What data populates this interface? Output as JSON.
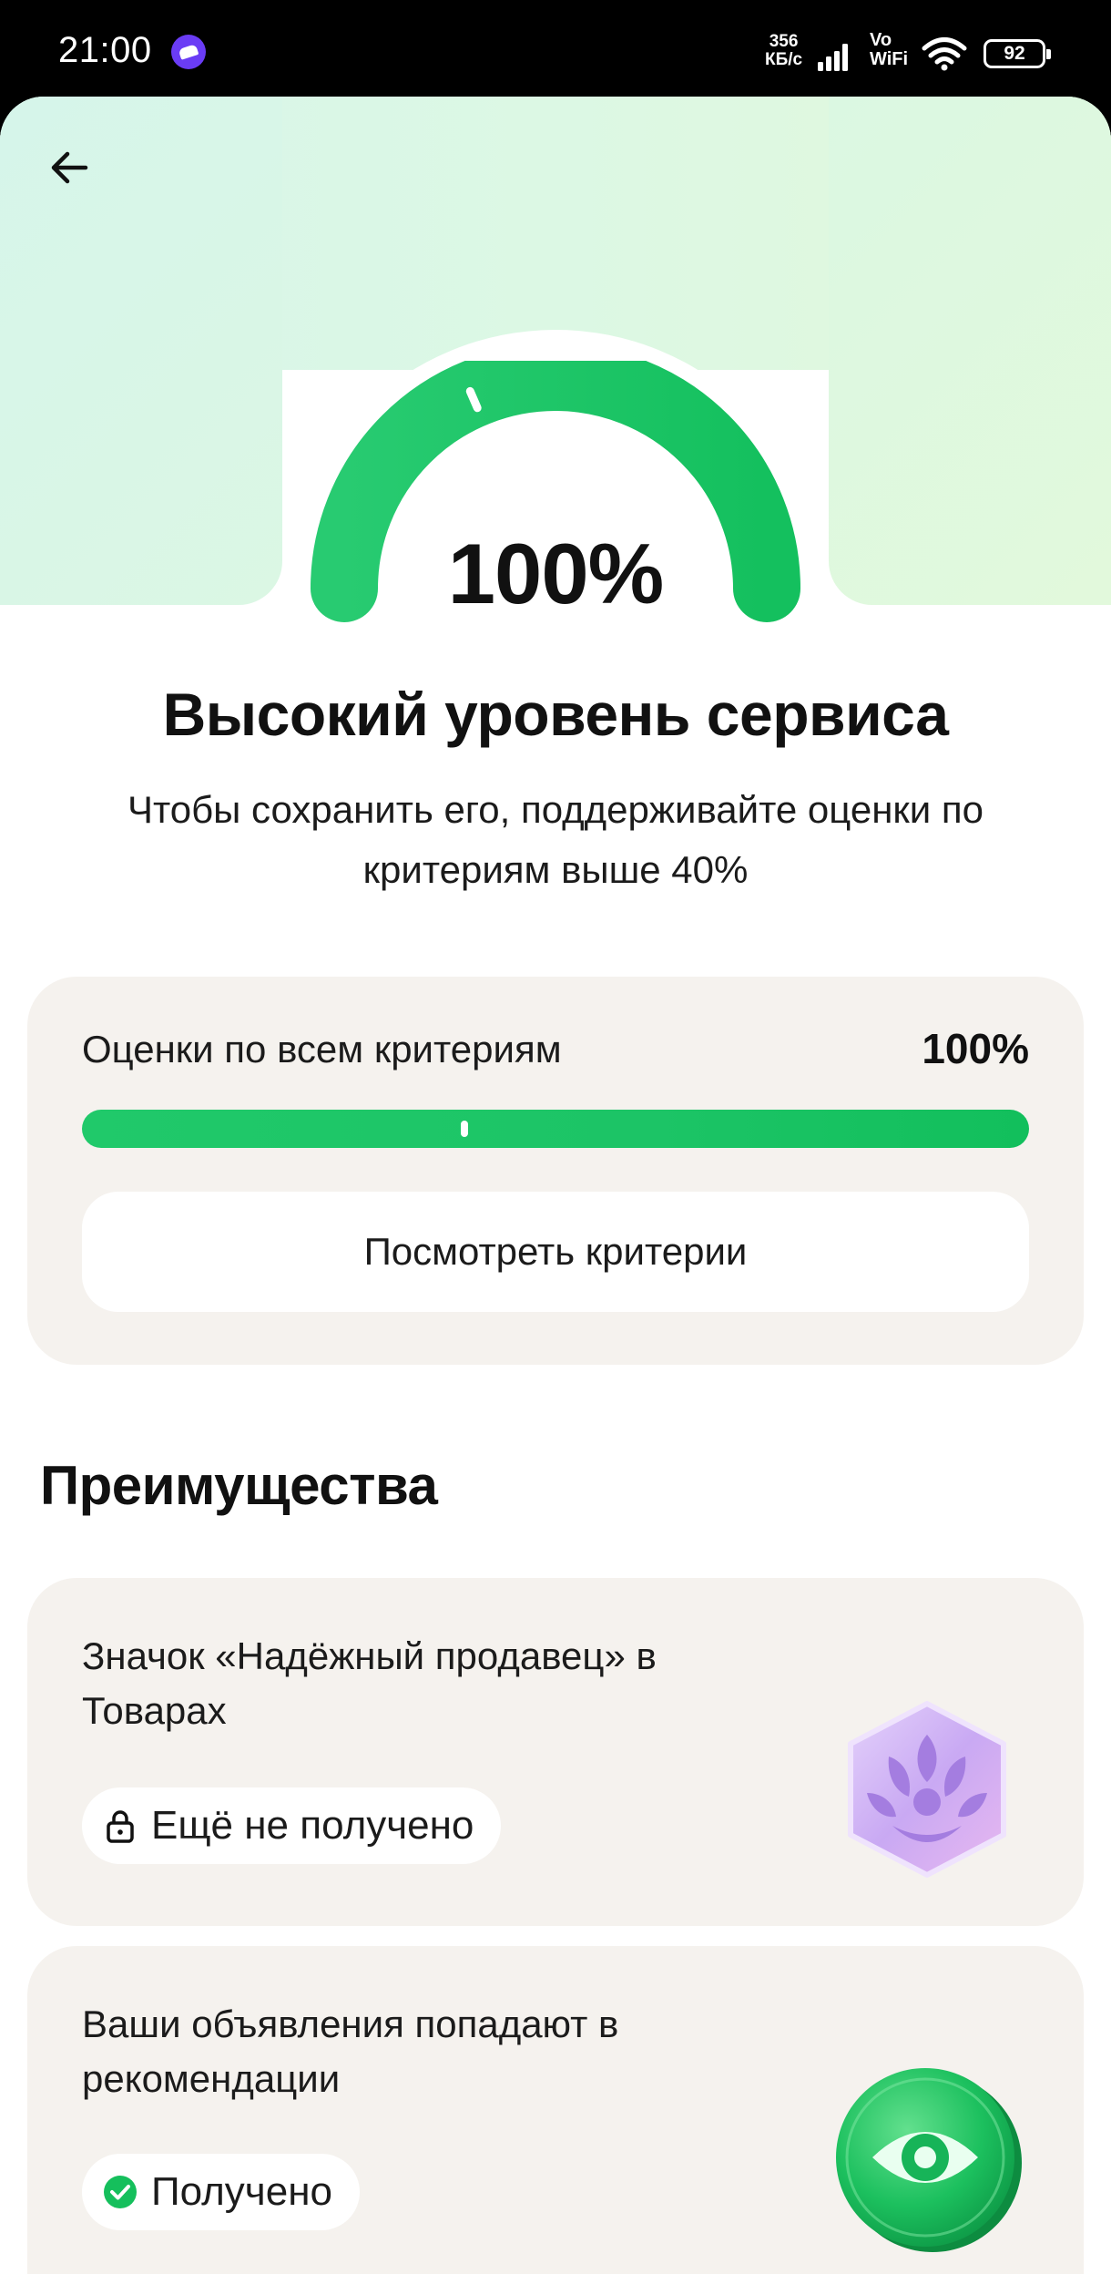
{
  "status_bar": {
    "time": "21:00",
    "net_speed_value": "356",
    "net_speed_unit": "КБ/с",
    "vowifi_top": "Vo",
    "vowifi_bottom": "WiFi",
    "battery": "92"
  },
  "header": {
    "back_icon": "arrow-left-icon"
  },
  "gauge": {
    "value_text": "100%",
    "level_percent": 100,
    "marker_percent": 37,
    "color": "#1cc466"
  },
  "main": {
    "title": "Высокий уровень сервиса",
    "subtitle": "Чтобы сохранить его, поддерживайте оценки по критериям выше 40%"
  },
  "score_card": {
    "label": "Оценки по всем критериям",
    "value_text": "100%",
    "fill_percent": 100,
    "marker_percent": 40,
    "button_label": "Посмотреть критерии"
  },
  "advantages": {
    "title": "Преимущества",
    "items": [
      {
        "text": "Значок «Надёжный продавец» в Товарах",
        "status": "Ещё не получено",
        "status_icon": "lock-icon",
        "badge_icon": "laurel-badge-icon",
        "badge_color": "#c7a6f2"
      },
      {
        "text": "Ваши объявления попадают в рекомендации",
        "status": "Получено",
        "status_icon": "check-circle-icon",
        "badge_icon": "eye-badge-icon",
        "badge_color": "#1fbf5e"
      }
    ]
  }
}
